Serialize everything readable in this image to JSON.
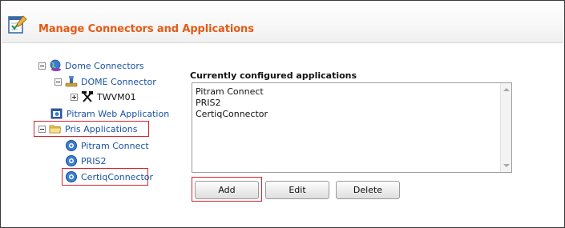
{
  "header": {
    "title": "Manage Connectors and Applications"
  },
  "tree": {
    "dome_connectors": "Dome Connectors",
    "dome_connector": "DOME Connector",
    "twvm": "TWVM01",
    "pitram_web": "Pitram Web Application",
    "pris_apps": "Pris Applications",
    "pitram_connect": "Pitram Connect",
    "pris2": "PRIS2",
    "certiq": "CertiqConnector"
  },
  "panel": {
    "title": "Currently configured applications",
    "applications": [
      "Pitram Connect",
      "PRIS2",
      "CertiqConnector"
    ]
  },
  "buttons": {
    "add": "Add",
    "edit": "Edit",
    "delete": "Delete"
  },
  "colors": {
    "accent": "#e35b16",
    "link": "#1a52a8",
    "highlight": "#d8232a"
  }
}
